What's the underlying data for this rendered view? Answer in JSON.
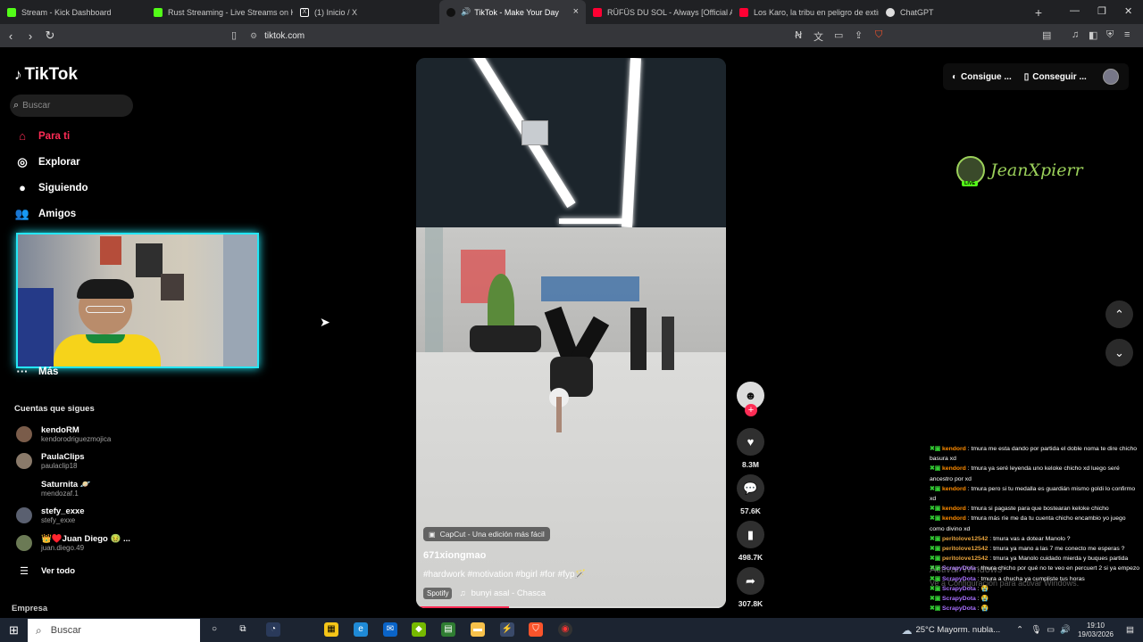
{
  "browser": {
    "tabs": [
      {
        "label": "Stream - Kick Dashboard",
        "color": "#53fc18",
        "active": false
      },
      {
        "label": "Rust Streaming - Live Streams on Ki",
        "color": "#53fc18",
        "active": false
      },
      {
        "label": "(1) Inicio / X",
        "color": "#ffffff",
        "active": false
      },
      {
        "label": "TikTok - Make Your Day",
        "color": "#ffffff",
        "active": true
      },
      {
        "label": "RÜFÜS DU SOL - Always [Official Au",
        "color": "#ff0033",
        "active": false
      },
      {
        "label": "Los Karo, la tribu en peligro de extin",
        "color": "#ff0033",
        "active": false
      },
      {
        "label": "ChatGPT",
        "color": "#dddddd",
        "active": false
      }
    ],
    "new_tab": "+",
    "close_glyph": "×",
    "url": "tiktok.com"
  },
  "sidebar": {
    "logo": "TikTok",
    "search_placeholder": "Buscar",
    "nav": [
      {
        "label": "Para ti",
        "icon": "home-icon",
        "active": true
      },
      {
        "label": "Explorar",
        "icon": "compass-icon",
        "active": false
      },
      {
        "label": "Siguiendo",
        "icon": "following-icon",
        "active": false
      },
      {
        "label": "Amigos",
        "icon": "friends-icon",
        "active": false
      }
    ],
    "more_label": "Más",
    "following_title": "Cuentas que sigues",
    "accounts": [
      {
        "name": "kendoRM",
        "handle": "kendorodriguezmojica"
      },
      {
        "name": "PaulaClips",
        "handle": "paulaclip18"
      },
      {
        "name": "Saturnita 🪐",
        "handle": "mendozaf.1"
      },
      {
        "name": "stefy_exxe",
        "handle": "stefy_exxe"
      },
      {
        "name": "👑♥️Juan Diego 🤢 ...",
        "handle": "juan.diego.49"
      }
    ],
    "see_all": "Ver todo",
    "empresa": "Empresa"
  },
  "video": {
    "capcut": "CapCut - Una edición más fácil",
    "author": "671xiongmao",
    "caption": "#hardwork #motivation #bgirl #for #fyp🪄",
    "music_badge": "Spotify",
    "music": "bunyi asal - Chasca",
    "progress": 0.3
  },
  "actions": {
    "likes": "8.3M",
    "comments": "57.6K",
    "saves": "498.7K",
    "shares": "307.8K"
  },
  "header_right": {
    "btn1": "Consigue ...",
    "btn2": "Conseguir ..."
  },
  "overlay": {
    "streamer": "JeanXpierr",
    "live": "LIVE"
  },
  "chat": [
    {
      "user": "kendord",
      "color": "#ff8c00",
      "msg": " : tmura me esta dando por partida el doble noma te dire chicho basura xd"
    },
    {
      "user": "kendord",
      "color": "#ff8c00",
      "msg": " : tmura ya seré leyenda uno keloke chicho xd luego seré ancestro por xd"
    },
    {
      "user": "kendord",
      "color": "#ff8c00",
      "msg": " : tmura pero si tu medalla es guardián mismo goldi lo confirmo xd"
    },
    {
      "user": "kendord",
      "color": "#ff8c00",
      "msg": " : tmura si pagaste para que bostearan keloke chicho"
    },
    {
      "user": "kendord",
      "color": "#ff8c00",
      "msg": " : tmura más ríe me da tu cuenta chicho encambio yo juego como divino xd"
    },
    {
      "user": "peritolove12542",
      "color": "#e6a23c",
      "msg": " : tmura vas a dotear Manolo ?"
    },
    {
      "user": "peritolove12542",
      "color": "#e6a23c",
      "msg": " : tmura ya mano a las 7 me conecto me esperas ?"
    },
    {
      "user": "peritolove12542",
      "color": "#e6a23c",
      "msg": " : tmura ya Manolo cuidado mierda y buques partida"
    },
    {
      "user": "ScrapyDota",
      "color": "#a970ff",
      "msg": " : tmura chicho por qué no te veo en percuert 2 si ya empezo"
    },
    {
      "user": "ScrapyDota",
      "color": "#a970ff",
      "msg": " : tmura a chucha ya cumpliste tus horas"
    },
    {
      "user": "ScrapyDota",
      "color": "#a970ff",
      "msg": " : 😭"
    },
    {
      "user": "ScrapyDota",
      "color": "#a970ff",
      "msg": " : 😭"
    },
    {
      "user": "ScrapyDota",
      "color": "#a970ff",
      "msg": " : 😭"
    }
  ],
  "watermark": {
    "line1": "Activar Windows",
    "line2": "Ve a Configuración para activar Windows."
  },
  "taskbar": {
    "search": "Buscar",
    "weather": "25°C  Mayorm. nubla...",
    "time": "19:10",
    "date": "19/03/2026"
  }
}
